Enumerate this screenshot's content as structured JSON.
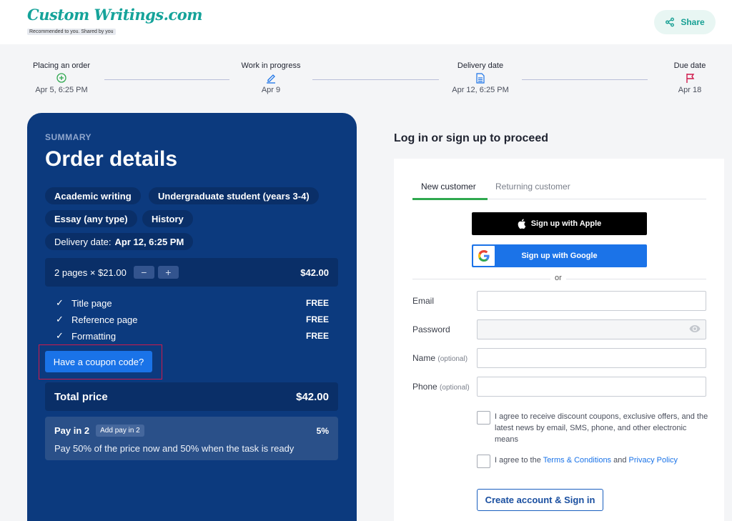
{
  "header": {
    "logo_text": "Custom Writings.com",
    "logo_tagline": "Recommended to you. Shared by you",
    "share_label": "Share",
    "share_icon": "share-icon",
    "brand_color": "#15a39a"
  },
  "timeline": {
    "steps": [
      {
        "title": "Placing an order",
        "date": "Apr 5, 6:25 PM",
        "icon": "plus-circle-icon",
        "color": "#2fa84f"
      },
      {
        "title": "Work in progress",
        "date": "Apr 9",
        "icon": "pencil-icon",
        "color": "#1a73e8"
      },
      {
        "title": "Delivery date",
        "date": "Apr 12, 6:25 PM",
        "icon": "document-icon",
        "color": "#1a73e8"
      },
      {
        "title": "Due date",
        "date": "Apr 18",
        "icon": "flag-icon",
        "color": "#d0194b"
      }
    ]
  },
  "summary": {
    "label": "SUMMARY",
    "title": "Order details",
    "chips": {
      "academic": "Academic writing",
      "level": "Undergraduate student (years 3-4)",
      "type": "Essay (any type)",
      "subject": "History",
      "delivery_label": "Delivery date:",
      "delivery_value": "Apr 12, 6:25 PM"
    },
    "pages": {
      "label": "2 pages × $21.00",
      "minus": "−",
      "plus": "+",
      "price": "$42.00"
    },
    "features": [
      {
        "label": "Title page",
        "price": "FREE"
      },
      {
        "label": "Reference page",
        "price": "FREE"
      },
      {
        "label": "Formatting",
        "price": "FREE"
      }
    ],
    "coupon_label": "Have a coupon code?",
    "total_label": "Total price",
    "total_value": "$42.00",
    "payin": {
      "title": "Pay in 2",
      "badge": "Add pay in 2",
      "percent": "5%",
      "description": "Pay 50% of the price now and 50% when the task is ready"
    },
    "panel_color": "#0c3a7e"
  },
  "auth": {
    "title": "Log in or sign up to proceed",
    "tabs": {
      "active": "New customer",
      "inactive": "Returning customer"
    },
    "apple_label": "Sign up with Apple",
    "google_label": "Sign up with Google",
    "or_text": "or",
    "fields": {
      "email_label": "Email",
      "password_label": "Password",
      "name_label": "Name",
      "name_optional": "(optional)",
      "phone_label": "Phone",
      "phone_optional": "(optional)"
    },
    "checkbox_offers": "I agree to receive discount coupons, exclusive offers, and the latest news by email, SMS, phone, and other electronic means",
    "checkbox_terms_prefix": "I agree to the",
    "terms_link": "Terms & Conditions",
    "and_text": "and",
    "privacy_link": "Privacy Policy",
    "create_label": "Create account & Sign in"
  }
}
